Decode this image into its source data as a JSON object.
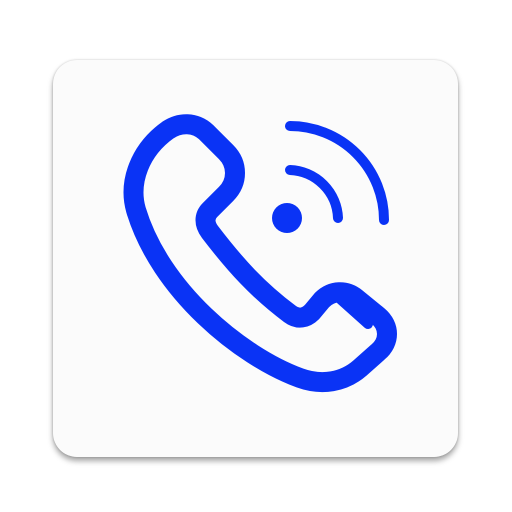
{
  "app_icon": {
    "icon_name": "phone-call-ringing-icon",
    "accent_color": "#0a33f5",
    "tile_color": "#fbfbfb",
    "shadow_color": "rgba(0,0,0,0.35)"
  }
}
